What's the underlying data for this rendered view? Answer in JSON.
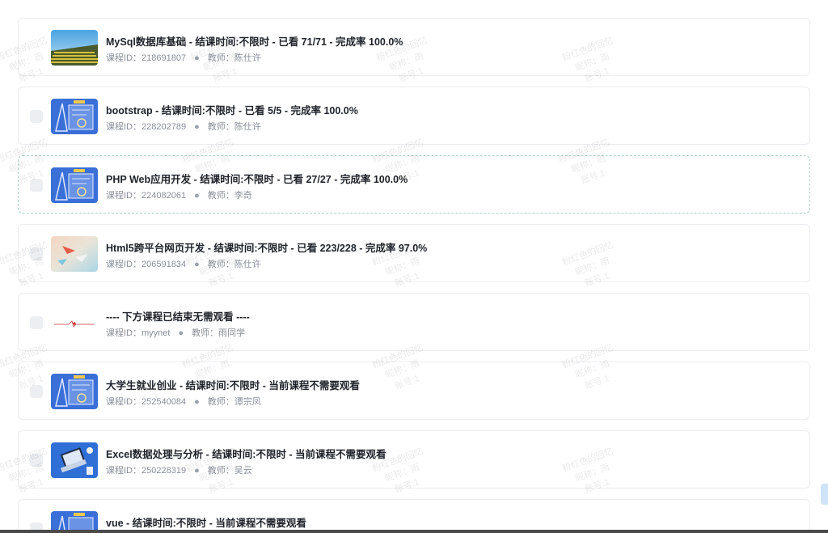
{
  "meta_labels": {
    "course_id": "课程ID：",
    "teacher": "教师：",
    "separator": "●"
  },
  "courses": [
    {
      "title": "MySql数据库基础 - 结课时间:不限时 - 已看 71/71 - 完成率 100.0%",
      "course_id": "218691807",
      "teacher": "陈仕许",
      "thumb_icon": "stairs-photo-icon"
    },
    {
      "title": "bootstrap - 结课时间:不限时 - 已看 5/5 - 完成率 100.0%",
      "course_id": "228202789",
      "teacher": "陈仕许",
      "thumb_icon": "blueprint-tools-icon"
    },
    {
      "title": "PHP Web应用开发 - 结课时间:不限时 - 已看 27/27 - 完成率 100.0%",
      "course_id": "224082061",
      "teacher": "李奇",
      "thumb_icon": "blueprint-tools-icon"
    },
    {
      "title": "Html5跨平台网页开发 - 结课时间:不限时 - 已看 223/228 - 完成率 97.0%",
      "course_id": "206591834",
      "teacher": "陈仕许",
      "thumb_icon": "paper-planes-icon"
    },
    {
      "title": "---- 下方课程已结束无需观看 ----",
      "course_id": "myynet",
      "teacher": "雨同学",
      "thumb_icon": "heartbeat-line-icon"
    },
    {
      "title": "大学生就业创业 - 结课时间:不限时 - 当前课程不需要观看",
      "course_id": "252540084",
      "teacher": "谭宗凤",
      "thumb_icon": "blueprint-tools-icon"
    },
    {
      "title": "Excel数据处理与分析 - 结课时间:不限时 - 当前课程不需要观看",
      "course_id": "250228319",
      "teacher": "吴云",
      "thumb_icon": "laptop-desk-icon"
    },
    {
      "title": "vue - 结课时间:不限时 - 当前课程不需要观看",
      "course_id": "",
      "teacher": "",
      "thumb_icon": "blueprint-tools-icon"
    }
  ],
  "watermark": {
    "line1": "粉红色的回忆",
    "line2": "昵称：雨",
    "line3": "账号:1"
  },
  "colors": {
    "title": "#1f2329",
    "meta": "#8a8f99",
    "border": "#ebedf0",
    "thumb_blue": "#3a6fd8"
  }
}
